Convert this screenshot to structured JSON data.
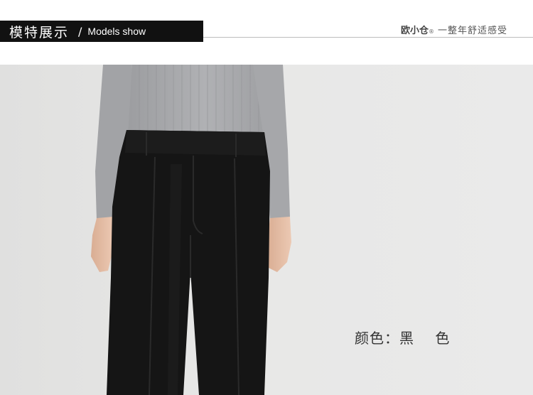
{
  "header": {
    "title_cn": "模特展示",
    "separator": "/",
    "title_en": "Models show",
    "brand_name": "欧小仓",
    "brand_reg": "®",
    "brand_slogan": "一整年舒适感受"
  },
  "photo": {
    "color_label": "颜色：黑    色"
  },
  "colors": {
    "title_bar": "#111111",
    "background": "#e6e6e5",
    "sweater": "#a9aaad",
    "trousers": "#141414",
    "skin": "#e6c1aa"
  }
}
